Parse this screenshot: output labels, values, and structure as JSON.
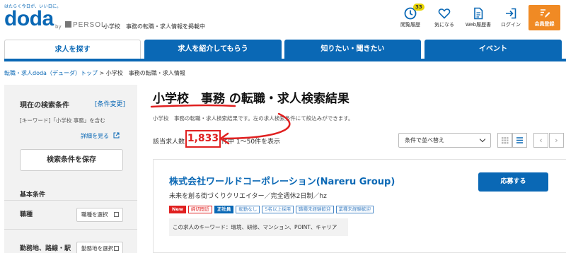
{
  "header": {
    "tagline": "はたらく今日が、いい日に。",
    "logo_text": "doda",
    "by_text": "by",
    "partner_text": "PERSOL",
    "description": "小学校　事務の転職・求人情報を掲載中",
    "buttons": [
      {
        "label": "閲覧履歴",
        "icon": "clock-icon",
        "badge": "33"
      },
      {
        "label": "気になる",
        "icon": "heart-icon"
      },
      {
        "label": "Web履歴書",
        "icon": "document-icon"
      },
      {
        "label": "ログイン",
        "icon": "login-icon"
      }
    ],
    "register_label": "会員登録"
  },
  "nav": {
    "tabs": [
      "求人を探す",
      "求人を紹介してもらう",
      "知りたい・聞きたい",
      "イベント"
    ]
  },
  "breadcrumb": {
    "home": "転職・求人doda（デューダ）トップ",
    "separator": " > ",
    "current": "小学校　事務の転職・求人情報"
  },
  "sidebar": {
    "title": "現在の検索条件",
    "change_link": "[条件変更]",
    "condition": "[キーワード]「小学校 事務」を含む",
    "detail_link": "詳細を見る",
    "save_button": "検索条件を保存",
    "section_title": "基本条件",
    "rows": [
      {
        "label": "職種",
        "button": "職種を選択"
      },
      {
        "label": "勤務地、路線・駅",
        "button": "勤務地を選択"
      }
    ]
  },
  "main": {
    "title_keyword": "小学校　事務",
    "title_rest": " の転職・求人検索結果",
    "subtitle": "小学校　事務の転職・求人検索結果です。左の求人検索条件にて絞込みができます。",
    "count_prefix": "該当求人数",
    "count": "1,833",
    "count_suffix": "件中 1～50件を表示",
    "sort_label": "条件で並べ替え",
    "pager_prev": "‹",
    "pager_next": "›"
  },
  "job": {
    "company": "株式会社ワールドコーポレーション(Nareru Group)",
    "catch": "未来を創る街づくりクリエイター／完全週休2日制／hz",
    "apply_label": "応募する",
    "tags": [
      {
        "text": "New",
        "style": "new"
      },
      {
        "text": "締切間近",
        "style": "red"
      },
      {
        "text": "正社員",
        "style": "solid"
      },
      {
        "text": "転勤なし",
        "style": "outline"
      },
      {
        "text": "5名以上採用",
        "style": "outline"
      },
      {
        "text": "職種未経験歓迎",
        "style": "outline"
      },
      {
        "text": "業種未経験歓迎",
        "style": "outline"
      }
    ],
    "keywords": "この求人のキーワード：環境、研修、マンション、POINT、キャリア"
  },
  "colors": {
    "brand_blue": "#0a68b5",
    "orange": "#f08a24",
    "annotation_red": "#e02020"
  }
}
